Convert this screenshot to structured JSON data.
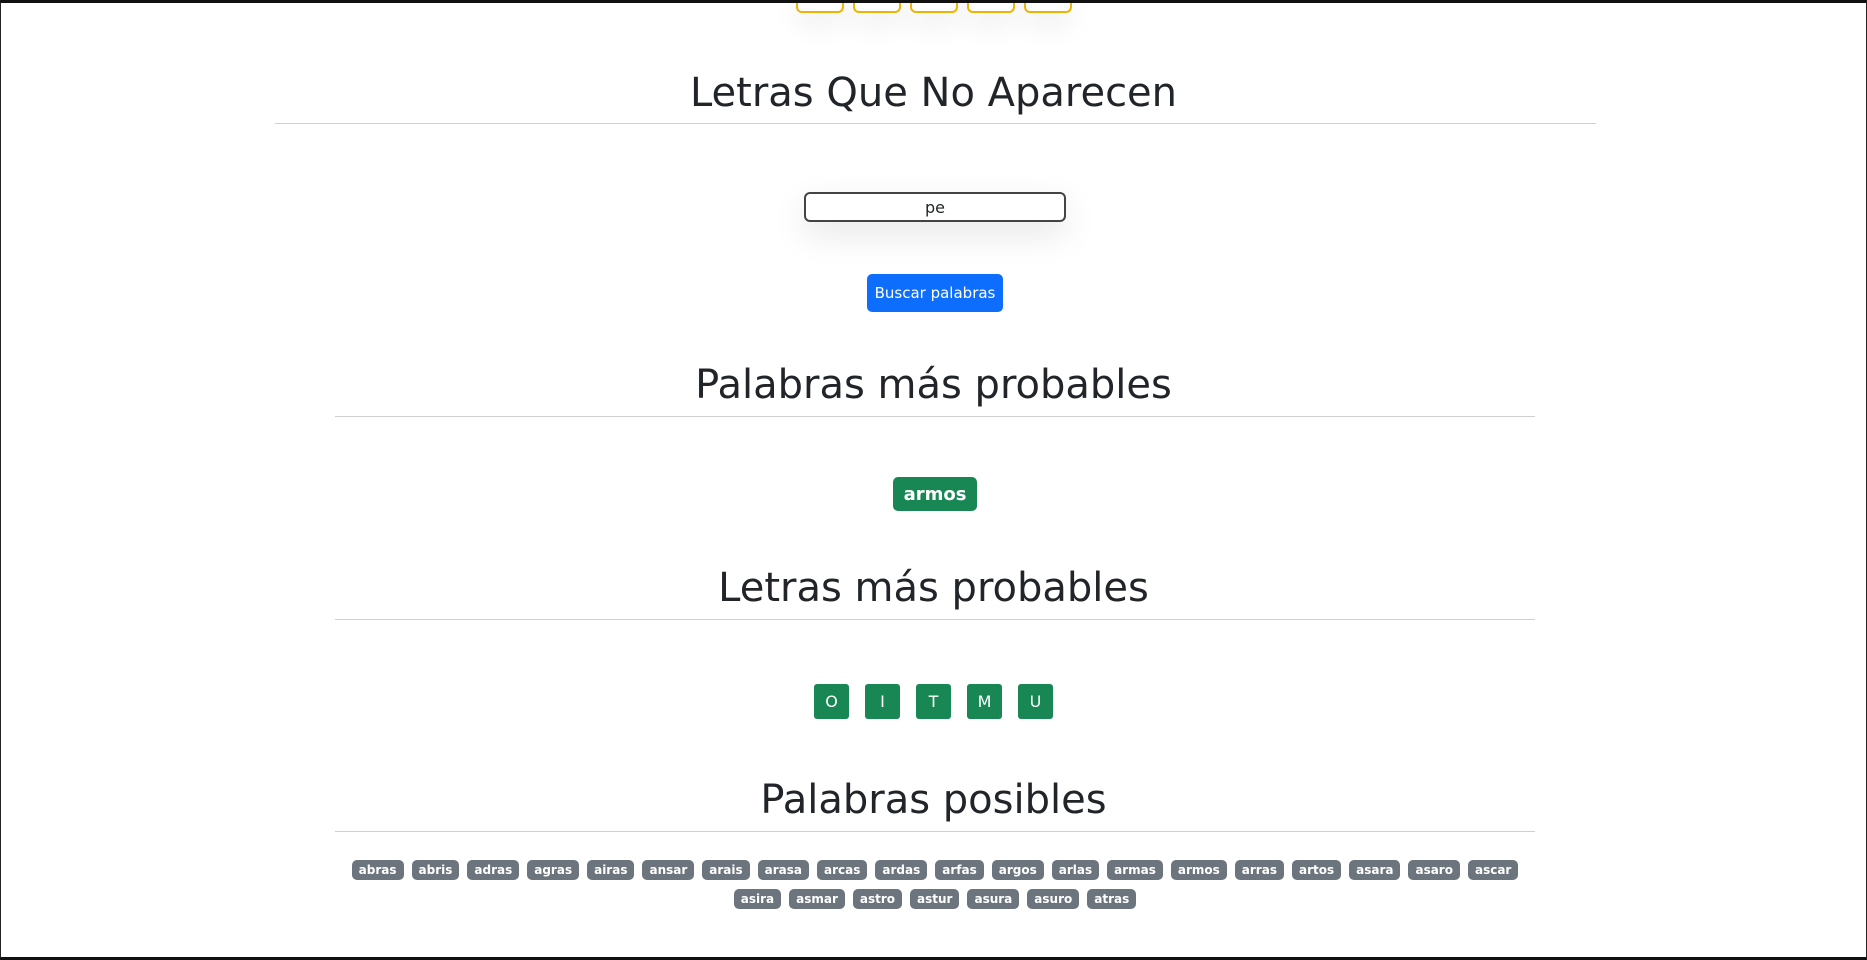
{
  "top_tiles": [
    "",
    "",
    "",
    "",
    ""
  ],
  "sections": {
    "missing_letters": {
      "title": "Letras Que No Aparecen",
      "input_value": "pe",
      "button_label": "Buscar palabras"
    },
    "probable_words": {
      "title": "Palabras más probables",
      "words": [
        "armos"
      ]
    },
    "probable_letters": {
      "title": "Letras más probables",
      "letters": [
        "O",
        "I",
        "T",
        "M",
        "U"
      ]
    },
    "possible_words": {
      "title": "Palabras posibles",
      "words": [
        "abras",
        "abris",
        "adras",
        "agras",
        "airas",
        "ansar",
        "arais",
        "arasa",
        "arcas",
        "ardas",
        "arfas",
        "argos",
        "arlas",
        "armas",
        "armos",
        "arras",
        "artos",
        "asara",
        "asaro",
        "ascar",
        "asira",
        "asmar",
        "astro",
        "astur",
        "asura",
        "asuro",
        "atras"
      ]
    }
  },
  "colors": {
    "primary": "#0d6efd",
    "success": "#198754",
    "secondary": "#6c757d",
    "warning": "#f0b400"
  }
}
